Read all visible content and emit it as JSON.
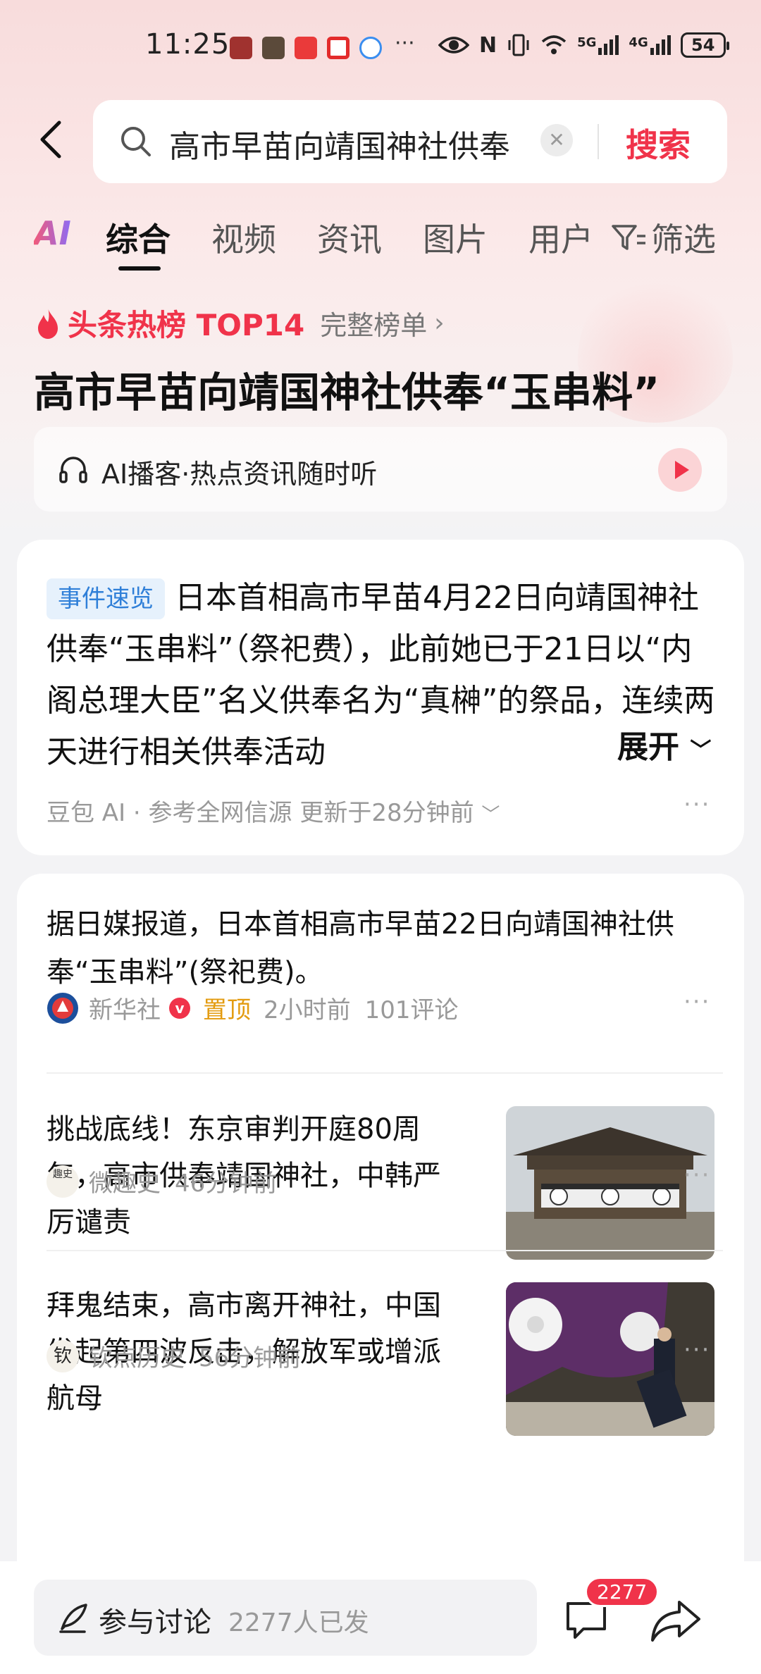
{
  "status_bar": {
    "time": "11:25",
    "more": "···",
    "network_5g": "5G",
    "network_4g": "4G",
    "battery": "54",
    "app_icons": [
      "huawei-icon",
      "shield-app-icon",
      "red-app-icon",
      "tv-app-icon",
      "chat-app-icon"
    ]
  },
  "search": {
    "query": "高市早苗向靖国神社供奉",
    "button": "搜索"
  },
  "tabs": {
    "ai": "AI",
    "items": [
      "综合",
      "视频",
      "资讯",
      "图片",
      "用户"
    ],
    "active": "综合",
    "filter": "筛选"
  },
  "hot": {
    "label": "头条热榜 TOP14",
    "full_list": "完整榜单",
    "title": "高市早苗向靖国神社供奉“玉串料”"
  },
  "podcast": {
    "text": "AI播客·热点资讯随时听"
  },
  "summary_card": {
    "tag": "事件速览",
    "text": "日本首相高市早苗4月22日向靖国神社供奉“玉串料”（祭祀费），此前她已于21日以“内阁总理大臣”名义供奉名为“真榊”的祭品，连续两天进行相关供奉活动",
    "expand": "展开",
    "source": "豆包 AI · 参考全网信源 更新于28分钟前",
    "more": "···"
  },
  "news": [
    {
      "title": "据日媒报道，日本首相高市早苗22日向靖国神社供奉“玉串料”(祭祀费)。",
      "source": "新华社",
      "verified": "v",
      "pinned": "置顶",
      "time": "2小时前",
      "comments": "101评论"
    },
    {
      "title": "挑战底线！东京审判开庭80周年，高市供奉靖国神社，中韩严厉谴责",
      "source": "微趣史",
      "avatar_text": "趣史",
      "time": "46分钟前"
    },
    {
      "title": "拜鬼结束，高市离开神社，中国发起第四波反击，解放军或增派航母",
      "source": "钦点历史",
      "avatar_text": "钦",
      "time": "56分钟前"
    }
  ],
  "bottom": {
    "discuss": "参与讨论",
    "discuss_count": "2277人已发",
    "comment_badge": "2277"
  },
  "colors": {
    "accent": "#f0334a",
    "tag_blue": "#2f7fd8",
    "pin_orange": "#e39b0f"
  }
}
